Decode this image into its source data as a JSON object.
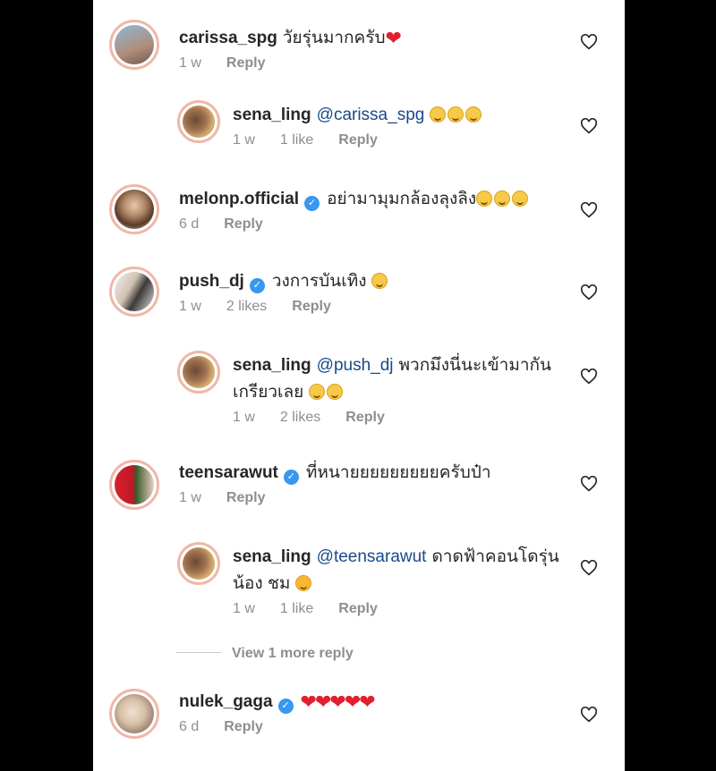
{
  "comments": [
    {
      "user": "carissa_spg",
      "text": "วัยรุ่นมากครับ",
      "suffix": "❤",
      "time": "1 w",
      "likes": "",
      "reply": "Reply",
      "verified": false
    },
    {
      "user": "sena_ling",
      "mention": "@carissa_spg",
      "text": "",
      "emoji": 3,
      "time": "1 w",
      "likes": "1 like",
      "reply": "Reply",
      "verified": false
    },
    {
      "user": "melonp.official",
      "text": "อย่ามามุมกล้องลุงลิง",
      "emoji": 3,
      "time": "6 d",
      "likes": "",
      "reply": "Reply",
      "verified": true
    },
    {
      "user": "push_dj",
      "text": "วงการบันเทิง",
      "emoji": 1,
      "time": "1 w",
      "likes": "2 likes",
      "reply": "Reply",
      "verified": true
    },
    {
      "user": "sena_ling",
      "mention": "@push_dj",
      "text": "พวกมึงนี่นะเข้ามากันเกรียวเลย",
      "emoji": 2,
      "time": "1 w",
      "likes": "2 likes",
      "reply": "Reply",
      "verified": false
    },
    {
      "user": "teensarawut",
      "text": "ที่หนายยยยยยยยยครับป๋า",
      "time": "1 w",
      "likes": "",
      "reply": "Reply",
      "verified": true
    },
    {
      "user": "sena_ling",
      "mention": "@teensarawut",
      "text": "ดาดฟ้าคอนโดรุ่นน้อง ชม",
      "emoji": 1,
      "time": "1 w",
      "likes": "1 like",
      "reply": "Reply",
      "verified": false
    },
    {
      "user": "nulek_gaga",
      "text": "",
      "suffix": "❤❤❤❤❤",
      "time": "6 d",
      "likes": "",
      "reply": "Reply",
      "verified": true
    }
  ],
  "view_more": "View 1 more reply",
  "colors": {
    "verified": "#3897f0",
    "mention": "#1a4a8a",
    "meta": "#8e8e8e",
    "heart": "#e0202e"
  }
}
